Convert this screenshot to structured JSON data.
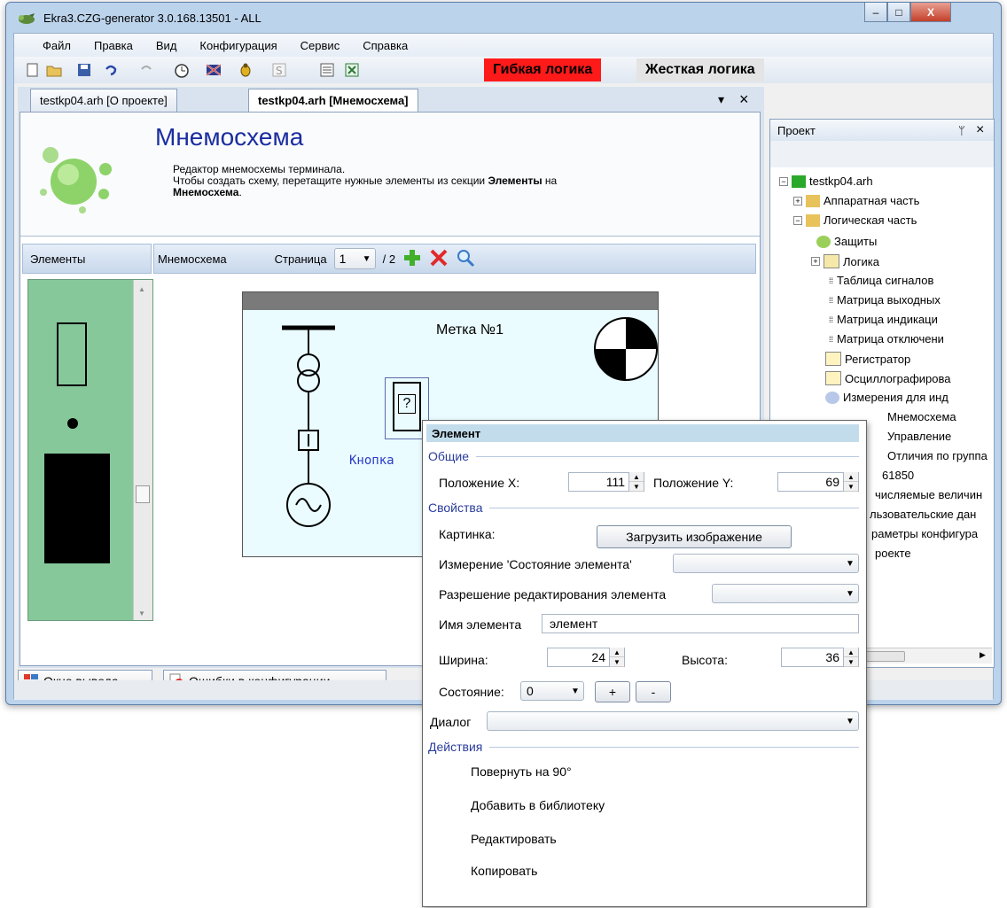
{
  "window": {
    "title": "Ekra3.CZG-generator 3.0.168.13501 - ALL",
    "controls": {
      "minimize": "–",
      "maximize": "□",
      "close": "X"
    }
  },
  "menu": [
    "Файл",
    "Правка",
    "Вид",
    "Конфигурация",
    "Сервис",
    "Справка"
  ],
  "modes": {
    "flexible": "Гибкая логика",
    "rigid": "Жесткая логика"
  },
  "tabs": [
    {
      "label": "testkp04.arh [О проекте]"
    },
    {
      "label": "testkp04.arh [Мнемосхема]"
    }
  ],
  "tabs_controls": {
    "dropdown": "▾",
    "close": "×"
  },
  "header": {
    "title": "Мнемосхема",
    "desc_line1": "Редактор мнемосхемы терминала.",
    "desc_line2_prefix": "Чтобы создать схему, перетащите нужные элементы из секции ",
    "desc_bold1": "Элементы",
    "desc_line2_suffix": " на",
    "desc_bold2": "Мнемосхема",
    "desc_end": "."
  },
  "elements_panel": {
    "label": "Элементы"
  },
  "mnemo_panel": {
    "label": "Мнемосхема",
    "page_label": "Страница",
    "page_value": "1",
    "page_total": "/ 2"
  },
  "canvas": {
    "label_text": "Метка №1",
    "button_text": "Кнопка"
  },
  "bottom_tabs": [
    {
      "label": "Окно вывода"
    },
    {
      "label": "Ошибки в конфигурации"
    }
  ],
  "project": {
    "title": "Проект",
    "pin": "ᛘ",
    "close": "×",
    "tree": [
      {
        "label": "testkp04.arh"
      },
      {
        "label": "Аппаратная часть"
      },
      {
        "label": "Логическая часть"
      },
      {
        "label": "Защиты"
      },
      {
        "label": "Логика"
      },
      {
        "label": "Таблица сигналов"
      },
      {
        "label": "Матрица выходных"
      },
      {
        "label": "Матрица индикаци"
      },
      {
        "label": "Матрица отключени"
      },
      {
        "label": "Регистратор"
      },
      {
        "label": "Осциллографирова"
      },
      {
        "label": "Измерения для инд"
      },
      {
        "label": "Мнемосхема"
      },
      {
        "label": "Управление"
      },
      {
        "label": "Отличия по группа"
      },
      {
        "label": "61850"
      },
      {
        "label": "числяемые величин"
      },
      {
        "label": "льзовательские дан"
      },
      {
        "label": "раметры конфигура"
      },
      {
        "label": "роекте"
      }
    ]
  },
  "popup": {
    "title": "Элемент",
    "sections": {
      "general": "Общие",
      "properties": "Свойства",
      "actions": "Действия"
    },
    "pos_x_label": "Положение X:",
    "pos_x_value": "111",
    "pos_y_label": "Положение Y:",
    "pos_y_value": "69",
    "picture_label": "Картинка:",
    "load_image_button": "Загрузить изображение",
    "measure_label": "Измерение 'Состояние элемента'",
    "edit_permission_label": "Разрешение редактирования элемента",
    "name_label": "Имя элемента",
    "name_value": "элемент",
    "width_label": "Ширина:",
    "width_value": "24",
    "height_label": "Высота:",
    "height_value": "36",
    "state_label": "Состояние:",
    "state_value": "0",
    "plus": "+",
    "minus": "-",
    "dialog_label": "Диалог",
    "actions": [
      "Повернуть на 90°",
      "Добавить в библиотеку",
      "Редактировать",
      "Копировать"
    ]
  },
  "colors": {
    "accent_red": "#ff1a1a",
    "palette_green": "#86c89a",
    "title_blue": "#1a2da0"
  }
}
